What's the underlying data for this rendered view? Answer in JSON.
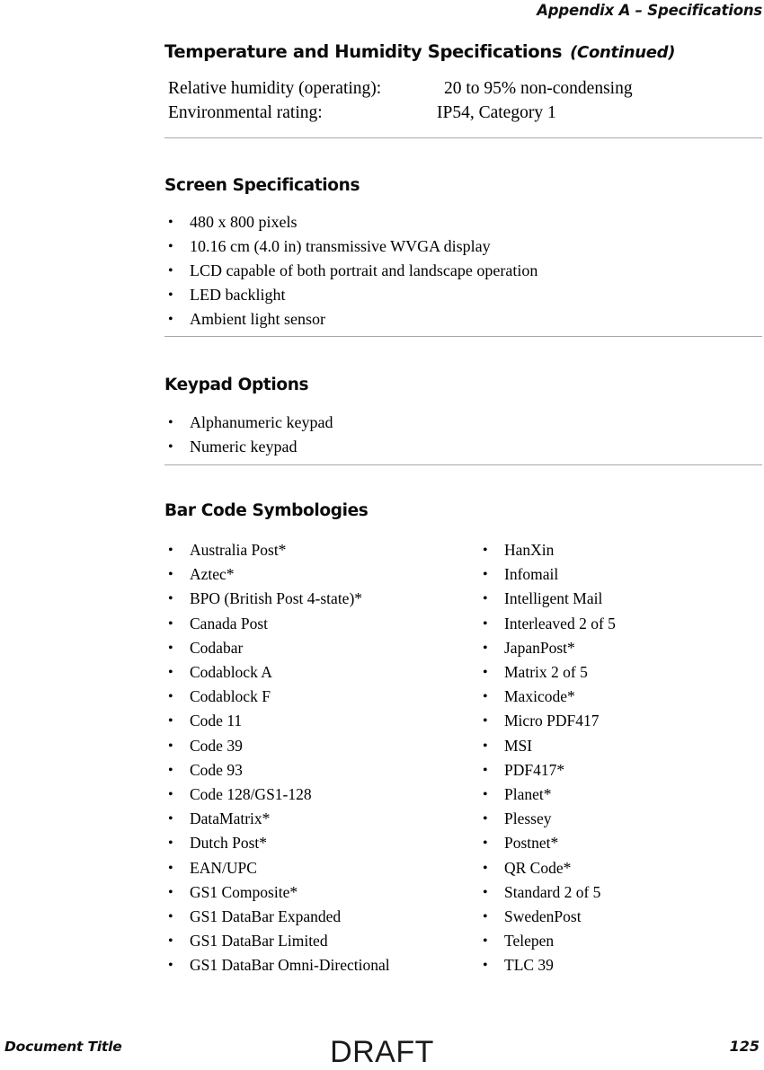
{
  "header": {
    "running_head": "Appendix A – Specifications"
  },
  "sections": {
    "temperature_humidity": {
      "title": "Temperature and Humidity Specifications",
      "continued_label": "(Continued)",
      "rows": [
        {
          "label": "Relative humidity (operating):",
          "value": "20 to 95% non-condensing"
        },
        {
          "label": "Environmental rating:",
          "value": "IP54, Category 1"
        }
      ]
    },
    "screen": {
      "title": "Screen Specifications",
      "items": [
        "480 x 800 pixels",
        "10.16 cm (4.0 in) transmissive WVGA display",
        "LCD capable of both portrait and landscape operation",
        "LED backlight",
        "Ambient light sensor"
      ]
    },
    "keypad": {
      "title": "Keypad Options",
      "items": [
        "Alphanumeric keypad",
        "Numeric keypad"
      ]
    },
    "barcode": {
      "title": "Bar Code Symbologies",
      "column_left": [
        "Australia Post*",
        "Aztec*",
        "BPO (British Post 4-state)*",
        "Canada Post",
        "Codabar",
        "Codablock A",
        "Codablock F",
        "Code 11",
        "Code 39",
        "Code 93",
        "Code 128/GS1-128",
        "DataMatrix*",
        "Dutch Post*",
        "EAN/UPC",
        "GS1 Composite*",
        "GS1 DataBar Expanded",
        "GS1 DataBar Limited",
        "GS1 DataBar Omni-Directional"
      ],
      "column_right": [
        "HanXin",
        "Infomail",
        "Intelligent Mail",
        "Interleaved 2 of 5",
        "JapanPost*",
        "Matrix 2 of 5",
        "Maxicode*",
        "Micro PDF417",
        "MSI",
        "PDF417*",
        "Planet*",
        "Plessey",
        "Postnet*",
        "QR Code*",
        "Standard 2 of 5",
        "SwedenPost",
        "Telepen",
        "TLC 39"
      ]
    }
  },
  "footer": {
    "document_title": "Document Title",
    "watermark": "DRAFT",
    "page_number": "125"
  }
}
